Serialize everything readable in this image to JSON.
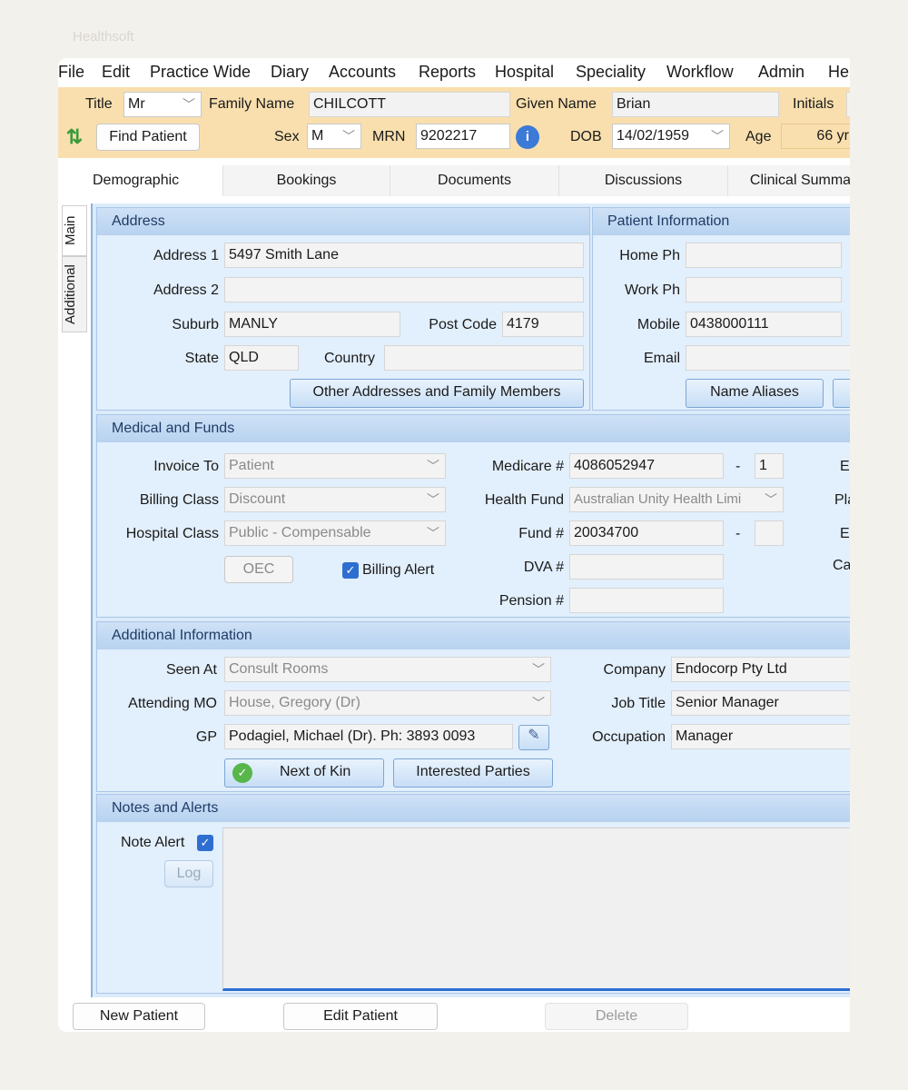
{
  "titlebar": "Healthsoft",
  "menu": [
    "File",
    "Edit",
    "Practice Wide",
    "Diary",
    "Accounts",
    "Reports",
    "Hospital",
    "Speciality",
    "Workflow",
    "Admin",
    "He"
  ],
  "header": {
    "title_label": "Title",
    "title_value": "Mr",
    "family_label": "Family Name",
    "family_value": "CHILCOTT",
    "given_label": "Given Name",
    "given_value": "Brian",
    "initials_label": "Initials",
    "find_patient": "Find Patient",
    "sex_label": "Sex",
    "sex_value": "M",
    "mrn_label": "MRN",
    "mrn_value": "9202217",
    "dob_label": "DOB",
    "dob_value": "14/02/1959",
    "age_label": "Age",
    "age_value": "66 yr"
  },
  "tabs": [
    "Demographic",
    "Bookings",
    "Documents",
    "Discussions",
    "Clinical Summa"
  ],
  "side_tabs": [
    "Main",
    "Additional"
  ],
  "address": {
    "title": "Address",
    "address1_label": "Address 1",
    "address1": "5497 Smith Lane",
    "address2_label": "Address 2",
    "address2": "",
    "suburb_label": "Suburb",
    "suburb": "MANLY",
    "postcode_label": "Post Code",
    "postcode": "4179",
    "state_label": "State",
    "state": "QLD",
    "country_label": "Country",
    "country": "",
    "other_btn": "Other Addresses and Family Members"
  },
  "patient_info": {
    "title": "Patient Information",
    "home_label": "Home Ph",
    "home": "",
    "work_label": "Work Ph",
    "work": "",
    "mobile_label": "Mobile",
    "mobile": "0438000111",
    "email_label": "Email",
    "email": "",
    "aliases_btn": "Name Aliases"
  },
  "medical": {
    "title": "Medical and Funds",
    "invoice_label": "Invoice To",
    "invoice": "Patient",
    "billing_label": "Billing Class",
    "billing": "Discount",
    "hospital_label": "Hospital Class",
    "hospital": "Public - Compensable",
    "oec_btn": "OEC",
    "billing_alert": "Billing Alert",
    "medicare_label": "Medicare #",
    "medicare": "4086052947",
    "medicare_dash": "-",
    "medicare_irn": "1",
    "fund_label": "Health Fund",
    "fund": "Australian Unity Health Limi",
    "fundno_label": "Fund #",
    "fundno": "20034700",
    "fund_dash": "-",
    "fund_suffix": "",
    "dva_label": "DVA #",
    "dva": "",
    "pension_label": "Pension #",
    "pension": "",
    "right_labels": [
      "Ex",
      "Pla",
      "Ex",
      "Ca"
    ]
  },
  "additional": {
    "title": "Additional Information",
    "seen_label": "Seen At",
    "seen": "Consult Rooms",
    "attending_label": "Attending MO",
    "attending": "House, Gregory (Dr)",
    "gp_label": "GP",
    "gp": "Podagiel, Michael (Dr). Ph: 3893 0093",
    "nok_btn": "Next of Kin",
    "parties_btn": "Interested Parties",
    "company_label": "Company",
    "company": "Endocorp Pty Ltd",
    "job_label": "Job Title",
    "job": "Senior Manager",
    "occupation_label": "Occupation",
    "occupation": "Manager"
  },
  "notes": {
    "title": "Notes and Alerts",
    "note_alert": "Note Alert",
    "log_btn": "Log"
  },
  "footer": {
    "new_patient": "New Patient",
    "edit_patient": "Edit Patient",
    "delete": "Delete"
  }
}
